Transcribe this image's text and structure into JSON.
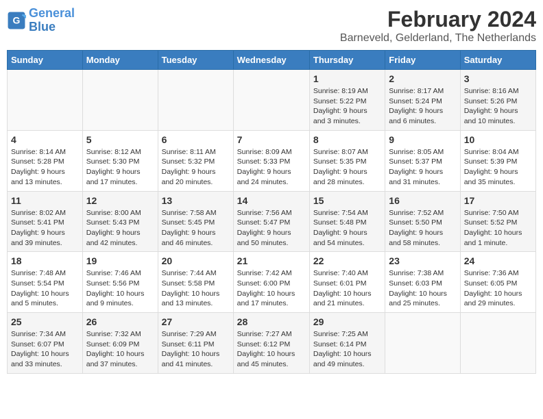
{
  "header": {
    "logo_line1": "General",
    "logo_line2": "Blue",
    "main_title": "February 2024",
    "subtitle": "Barneveld, Gelderland, The Netherlands"
  },
  "weekdays": [
    "Sunday",
    "Monday",
    "Tuesday",
    "Wednesday",
    "Thursday",
    "Friday",
    "Saturday"
  ],
  "weeks": [
    [
      {
        "day": "",
        "info": ""
      },
      {
        "day": "",
        "info": ""
      },
      {
        "day": "",
        "info": ""
      },
      {
        "day": "",
        "info": ""
      },
      {
        "day": "1",
        "info": "Sunrise: 8:19 AM\nSunset: 5:22 PM\nDaylight: 9 hours\nand 3 minutes."
      },
      {
        "day": "2",
        "info": "Sunrise: 8:17 AM\nSunset: 5:24 PM\nDaylight: 9 hours\nand 6 minutes."
      },
      {
        "day": "3",
        "info": "Sunrise: 8:16 AM\nSunset: 5:26 PM\nDaylight: 9 hours\nand 10 minutes."
      }
    ],
    [
      {
        "day": "4",
        "info": "Sunrise: 8:14 AM\nSunset: 5:28 PM\nDaylight: 9 hours\nand 13 minutes."
      },
      {
        "day": "5",
        "info": "Sunrise: 8:12 AM\nSunset: 5:30 PM\nDaylight: 9 hours\nand 17 minutes."
      },
      {
        "day": "6",
        "info": "Sunrise: 8:11 AM\nSunset: 5:32 PM\nDaylight: 9 hours\nand 20 minutes."
      },
      {
        "day": "7",
        "info": "Sunrise: 8:09 AM\nSunset: 5:33 PM\nDaylight: 9 hours\nand 24 minutes."
      },
      {
        "day": "8",
        "info": "Sunrise: 8:07 AM\nSunset: 5:35 PM\nDaylight: 9 hours\nand 28 minutes."
      },
      {
        "day": "9",
        "info": "Sunrise: 8:05 AM\nSunset: 5:37 PM\nDaylight: 9 hours\nand 31 minutes."
      },
      {
        "day": "10",
        "info": "Sunrise: 8:04 AM\nSunset: 5:39 PM\nDaylight: 9 hours\nand 35 minutes."
      }
    ],
    [
      {
        "day": "11",
        "info": "Sunrise: 8:02 AM\nSunset: 5:41 PM\nDaylight: 9 hours\nand 39 minutes."
      },
      {
        "day": "12",
        "info": "Sunrise: 8:00 AM\nSunset: 5:43 PM\nDaylight: 9 hours\nand 42 minutes."
      },
      {
        "day": "13",
        "info": "Sunrise: 7:58 AM\nSunset: 5:45 PM\nDaylight: 9 hours\nand 46 minutes."
      },
      {
        "day": "14",
        "info": "Sunrise: 7:56 AM\nSunset: 5:47 PM\nDaylight: 9 hours\nand 50 minutes."
      },
      {
        "day": "15",
        "info": "Sunrise: 7:54 AM\nSunset: 5:48 PM\nDaylight: 9 hours\nand 54 minutes."
      },
      {
        "day": "16",
        "info": "Sunrise: 7:52 AM\nSunset: 5:50 PM\nDaylight: 9 hours\nand 58 minutes."
      },
      {
        "day": "17",
        "info": "Sunrise: 7:50 AM\nSunset: 5:52 PM\nDaylight: 10 hours\nand 1 minute."
      }
    ],
    [
      {
        "day": "18",
        "info": "Sunrise: 7:48 AM\nSunset: 5:54 PM\nDaylight: 10 hours\nand 5 minutes."
      },
      {
        "day": "19",
        "info": "Sunrise: 7:46 AM\nSunset: 5:56 PM\nDaylight: 10 hours\nand 9 minutes."
      },
      {
        "day": "20",
        "info": "Sunrise: 7:44 AM\nSunset: 5:58 PM\nDaylight: 10 hours\nand 13 minutes."
      },
      {
        "day": "21",
        "info": "Sunrise: 7:42 AM\nSunset: 6:00 PM\nDaylight: 10 hours\nand 17 minutes."
      },
      {
        "day": "22",
        "info": "Sunrise: 7:40 AM\nSunset: 6:01 PM\nDaylight: 10 hours\nand 21 minutes."
      },
      {
        "day": "23",
        "info": "Sunrise: 7:38 AM\nSunset: 6:03 PM\nDaylight: 10 hours\nand 25 minutes."
      },
      {
        "day": "24",
        "info": "Sunrise: 7:36 AM\nSunset: 6:05 PM\nDaylight: 10 hours\nand 29 minutes."
      }
    ],
    [
      {
        "day": "25",
        "info": "Sunrise: 7:34 AM\nSunset: 6:07 PM\nDaylight: 10 hours\nand 33 minutes."
      },
      {
        "day": "26",
        "info": "Sunrise: 7:32 AM\nSunset: 6:09 PM\nDaylight: 10 hours\nand 37 minutes."
      },
      {
        "day": "27",
        "info": "Sunrise: 7:29 AM\nSunset: 6:11 PM\nDaylight: 10 hours\nand 41 minutes."
      },
      {
        "day": "28",
        "info": "Sunrise: 7:27 AM\nSunset: 6:12 PM\nDaylight: 10 hours\nand 45 minutes."
      },
      {
        "day": "29",
        "info": "Sunrise: 7:25 AM\nSunset: 6:14 PM\nDaylight: 10 hours\nand 49 minutes."
      },
      {
        "day": "",
        "info": ""
      },
      {
        "day": "",
        "info": ""
      }
    ]
  ]
}
